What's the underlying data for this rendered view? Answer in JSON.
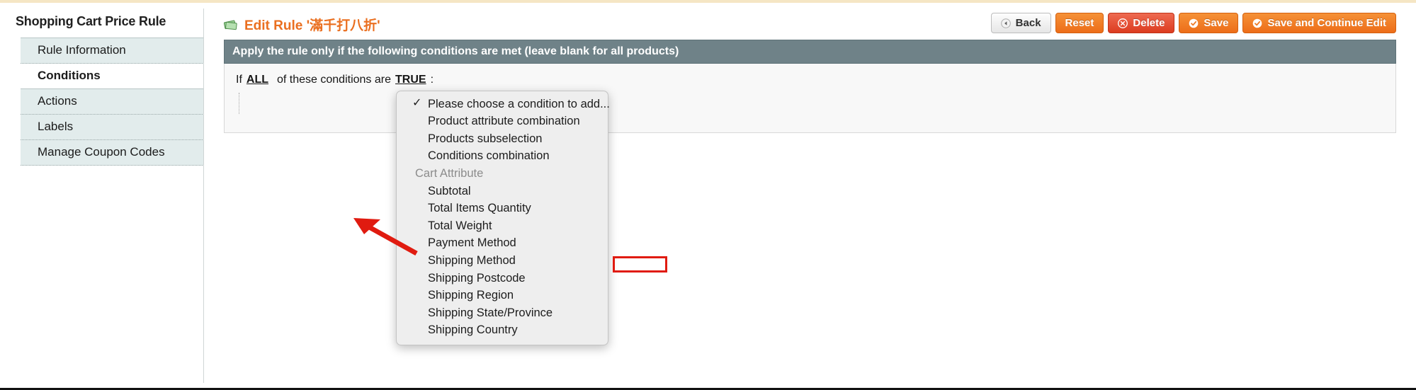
{
  "sidebar": {
    "title": "Shopping Cart Price Rule",
    "items": [
      {
        "label": "Rule Information",
        "active": false
      },
      {
        "label": "Conditions",
        "active": true
      },
      {
        "label": "Actions",
        "active": false
      },
      {
        "label": "Labels",
        "active": false
      },
      {
        "label": "Manage Coupon Codes",
        "active": false
      }
    ]
  },
  "header": {
    "title": "Edit Rule '滿千打八折'",
    "icon": "money-icon",
    "buttons": [
      {
        "label": "Back",
        "style": "gray",
        "icon": "back-arrow-icon"
      },
      {
        "label": "Reset",
        "style": "orange",
        "icon": ""
      },
      {
        "label": "Delete",
        "style": "red",
        "icon": "delete-x-icon"
      },
      {
        "label": "Save",
        "style": "orange",
        "icon": "check-circle-icon"
      },
      {
        "label": "Save and Continue Edit",
        "style": "orange",
        "icon": "check-circle-icon"
      }
    ]
  },
  "panel": {
    "heading": "Apply the rule only if the following conditions are met (leave blank for all products)",
    "condition_prefix": "If",
    "condition_all": "ALL",
    "condition_mid": "of these conditions are",
    "condition_true": "TRUE",
    "condition_suffix": ":"
  },
  "dropdown": {
    "selected": "Please choose a condition to add...",
    "highlighted": "Subtotal",
    "items": [
      {
        "label": "Please choose a condition to add...",
        "checked": true,
        "group": false,
        "indented": false
      },
      {
        "label": "Product attribute combination",
        "checked": false,
        "group": false,
        "indented": false
      },
      {
        "label": "Products subselection",
        "checked": false,
        "group": false,
        "indented": false
      },
      {
        "label": "Conditions combination",
        "checked": false,
        "group": false,
        "indented": false
      },
      {
        "label": "Cart Attribute",
        "checked": false,
        "group": true,
        "indented": false
      },
      {
        "label": "Subtotal",
        "checked": false,
        "group": false,
        "indented": true
      },
      {
        "label": "Total Items Quantity",
        "checked": false,
        "group": false,
        "indented": true
      },
      {
        "label": "Total Weight",
        "checked": false,
        "group": false,
        "indented": true
      },
      {
        "label": "Payment Method",
        "checked": false,
        "group": false,
        "indented": true
      },
      {
        "label": "Shipping Method",
        "checked": false,
        "group": false,
        "indented": true
      },
      {
        "label": "Shipping Postcode",
        "checked": false,
        "group": false,
        "indented": true
      },
      {
        "label": "Shipping Region",
        "checked": false,
        "group": false,
        "indented": true
      },
      {
        "label": "Shipping State/Province",
        "checked": false,
        "group": false,
        "indented": true
      },
      {
        "label": "Shipping Country",
        "checked": false,
        "group": false,
        "indented": true
      }
    ]
  },
  "annotation": {
    "color": "#e01b10",
    "shape": "arrow-pointing-to-subtotal"
  },
  "colors": {
    "accent_orange": "#ea6f20",
    "panel_header": "#6f8288",
    "sidebar_item": "#e2ecec",
    "delete_red": "#dc3c20",
    "annotation_red": "#e01b10",
    "top_strip": "#f5e6c4"
  }
}
